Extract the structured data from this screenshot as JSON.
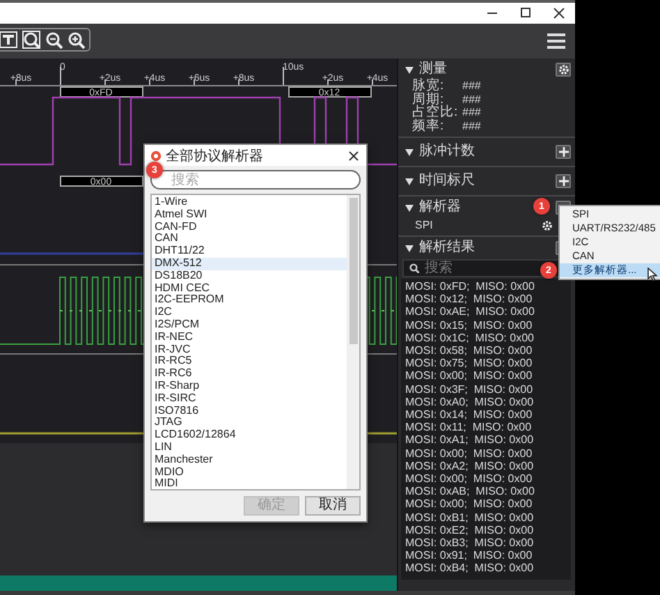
{
  "timeline": {
    "ticks": [
      {
        "label": "+8us",
        "kind": "minor"
      },
      {
        "label": "0",
        "kind": "major"
      },
      {
        "label": "+2us",
        "kind": "minor"
      },
      {
        "label": "+4us",
        "kind": "minor"
      },
      {
        "label": "+6us",
        "kind": "minor"
      },
      {
        "label": "+8us",
        "kind": "minor"
      },
      {
        "label": "10us",
        "kind": "major"
      },
      {
        "label": "+2us",
        "kind": "minor"
      },
      {
        "label": "+4us",
        "kind": "minor"
      }
    ]
  },
  "decode_rows": [
    {
      "segments": [
        "0xFD",
        "0x12"
      ]
    },
    {
      "segments": [
        "0x00"
      ]
    }
  ],
  "panel": {
    "sections": [
      {
        "kind": "measure",
        "title": "测量",
        "rows": [
          {
            "label": "脉宽:",
            "value": "###"
          },
          {
            "label": "周期:",
            "value": "###"
          },
          {
            "label": "占空比:",
            "value": "###"
          },
          {
            "label": "频率:",
            "value": "###"
          }
        ]
      },
      {
        "kind": "add",
        "title": "脉冲计数"
      },
      {
        "kind": "add",
        "title": "时间标尺"
      },
      {
        "kind": "decoders",
        "title": "解析器",
        "badge": "1",
        "items": [
          "SPI"
        ]
      },
      {
        "kind": "results",
        "title": "解析结果",
        "search": {
          "placeholder": "搜索"
        },
        "rows": [
          "MOSI: 0xFD;  MISO: 0x00",
          "MOSI: 0x12;  MISO: 0x00",
          "MOSI: 0xAE;  MISO: 0x00",
          "MOSI: 0x15;  MISO: 0x00",
          "MOSI: 0x1C;  MISO: 0x00",
          "MOSI: 0x58;  MISO: 0x00",
          "MOSI: 0x75;  MISO: 0x00",
          "MOSI: 0x00;  MISO: 0x00",
          "MOSI: 0x3F;  MISO: 0x00",
          "MOSI: 0xA0;  MISO: 0x00",
          "MOSI: 0x14;  MISO: 0x00",
          "MOSI: 0x11;  MISO: 0x00",
          "MOSI: 0xA1;  MISO: 0x00",
          "MOSI: 0x00;  MISO: 0x00",
          "MOSI: 0xA2;  MISO: 0x00",
          "MOSI: 0x00;  MISO: 0x00",
          "MOSI: 0xAB;  MISO: 0x00",
          "MOSI: 0x00;  MISO: 0x00",
          "MOSI: 0xB1;  MISO: 0x00",
          "MOSI: 0xE2;  MISO: 0x00",
          "MOSI: 0xB3;  MISO: 0x00",
          "MOSI: 0x91;  MISO: 0x00",
          "MOSI: 0xB4;  MISO: 0x00"
        ]
      }
    ]
  },
  "menu": {
    "items": [
      {
        "label": "SPI",
        "selected": false
      },
      {
        "label": "UART/RS232/485",
        "selected": false
      },
      {
        "label": "I2C",
        "selected": false
      },
      {
        "label": "CAN",
        "selected": false
      },
      {
        "label": "更多解析器...",
        "selected": true,
        "badge": "2"
      }
    ]
  },
  "dialog": {
    "title": "全部协议解析器",
    "search": {
      "placeholder": "搜索",
      "badge": "3"
    },
    "items": [
      {
        "label": "1-Wire",
        "selected": false
      },
      {
        "label": "Atmel SWI",
        "selected": false
      },
      {
        "label": "CAN-FD",
        "selected": false
      },
      {
        "label": "CAN",
        "selected": false
      },
      {
        "label": "DHT11/22",
        "selected": false
      },
      {
        "label": "DMX-512",
        "selected": true
      },
      {
        "label": "DS18B20",
        "selected": false
      },
      {
        "label": "HDMI CEC",
        "selected": false
      },
      {
        "label": "I2C-EEPROM",
        "selected": false
      },
      {
        "label": "I2C",
        "selected": false
      },
      {
        "label": "I2S/PCM",
        "selected": false
      },
      {
        "label": "IR-NEC",
        "selected": false
      },
      {
        "label": "IR-JVC",
        "selected": false
      },
      {
        "label": "IR-RC5",
        "selected": false
      },
      {
        "label": "IR-RC6",
        "selected": false
      },
      {
        "label": "IR-Sharp",
        "selected": false
      },
      {
        "label": "IR-SIRC",
        "selected": false
      },
      {
        "label": "ISO7816",
        "selected": false
      },
      {
        "label": "JTAG",
        "selected": false
      },
      {
        "label": "LCD1602/12864",
        "selected": false
      },
      {
        "label": "LIN",
        "selected": false
      },
      {
        "label": "Manchester",
        "selected": false
      },
      {
        "label": "MDIO",
        "selected": false
      },
      {
        "label": "MIDI",
        "selected": false
      }
    ],
    "buttons": [
      {
        "label": "确定",
        "disabled": true
      },
      {
        "label": "取消",
        "disabled": false
      }
    ]
  }
}
